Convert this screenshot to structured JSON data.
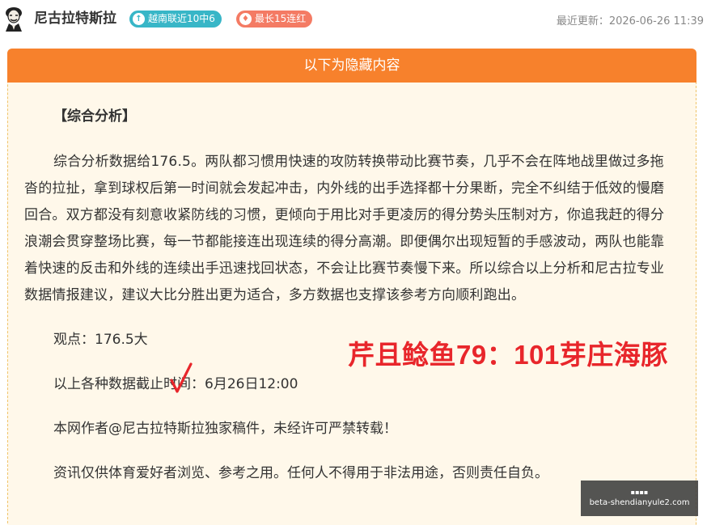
{
  "header": {
    "author_name": "尼古拉特斯拉",
    "badges": [
      {
        "label": "越南联近10中6",
        "color": "#38b6c7",
        "icon": "up-arrow-icon"
      },
      {
        "label": "最长15连红",
        "color": "#f47b64",
        "icon": "fire-icon"
      }
    ],
    "update_time": "最近更新：2026-06-26 11:39"
  },
  "hidden_section": {
    "banner_label": "以下为隐藏内容",
    "banner_color": "#f7812c"
  },
  "article": {
    "section_title": "【综合分析】",
    "paragraph": "综合分析数据给176.5。两队都习惯用快速的攻防转换带动比赛节奏，几乎不会在阵地战里做过多拖沓的拉扯，拿到球权后第一时间就会发起冲击，内外线的出手选择都十分果断，完全不纠结于低效的慢磨回合。双方都没有刻意收紧防线的习惯，更倾向于用比对手更凌厉的得分势头压制对方，你追我赶的得分浪潮会贯穿整场比赛，每一节都能接连出现连续的得分高潮。即便偶尔出现短暂的手感波动，两队也能靠着快速的反击和外线的连续出手迅速找回状态，不会让比赛节奏慢下来。所以综合以上分析和尼古拉专业数据情报建议，建议大比分胜出更为适合，多方数据也支撑该参考方向顺利跑出。",
    "viewpoint": "观点：176.5大",
    "cutoff": "以上各种数据截止时间：6月26日12:00",
    "copyright": "本网作者@尼古拉特斯拉独家稿件，未经许可严禁转载！",
    "disclaimer": "资讯仅供体育爱好者浏览、参考之用。任何人不得用于非法用途，否则责任自负。"
  },
  "overlay": {
    "score_text": "芹且鲶鱼79：101芽庄海豚",
    "color": "#e8262b",
    "checkmark_icon": "checkmark-icon"
  },
  "watermark": {
    "domain": "beta-shendianyule2.com"
  }
}
